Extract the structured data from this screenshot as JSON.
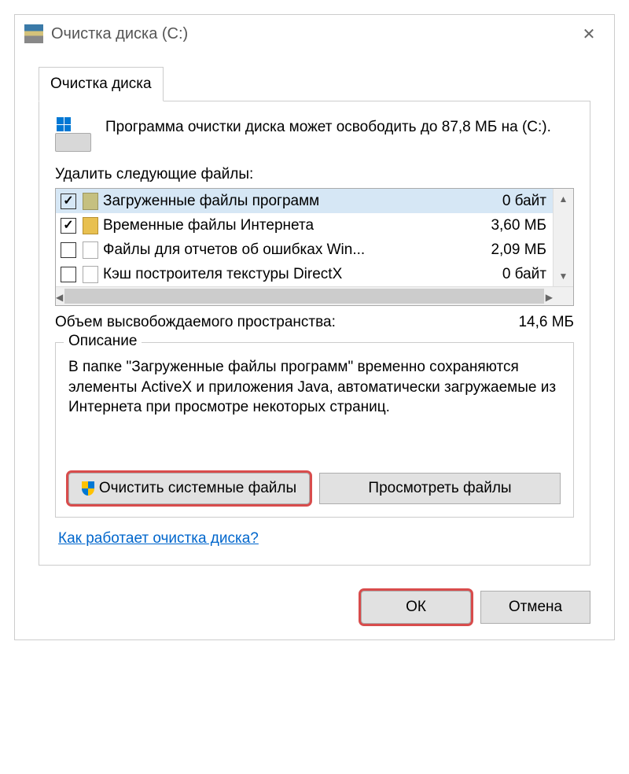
{
  "title": "Очистка диска  (C:)",
  "tab": {
    "label": "Очистка диска"
  },
  "info_text": "Программа очистки диска может освободить до 87,8 МБ на  (C:).",
  "files_label": "Удалить следующие файлы:",
  "files": [
    {
      "name": "Загруженные файлы программ",
      "size": "0 байт",
      "checked": true,
      "icon": "folder",
      "selected": true
    },
    {
      "name": "Временные файлы Интернета",
      "size": "3,60 МБ",
      "checked": true,
      "icon": "lock",
      "selected": false
    },
    {
      "name": "Файлы для отчетов об ошибках Win...",
      "size": "2,09 МБ",
      "checked": false,
      "icon": "doc",
      "selected": false
    },
    {
      "name": "Кэш построителя текстуры DirectX",
      "size": "0 байт",
      "checked": false,
      "icon": "doc",
      "selected": false
    }
  ],
  "freespace": {
    "label": "Объем высвобождаемого пространства:",
    "value": "14,6 МБ"
  },
  "group": {
    "title": "Описание",
    "description": "В папке \"Загруженные файлы программ\" временно сохраняются элементы ActiveX и приложения Java, автоматически загружаемые из Интернета при просмотре некоторых страниц."
  },
  "buttons": {
    "clean_system": "Очистить системные файлы",
    "view_files": "Просмотреть файлы",
    "ok": "ОК",
    "cancel": "Отмена"
  },
  "link": "Как работает очистка диска?"
}
